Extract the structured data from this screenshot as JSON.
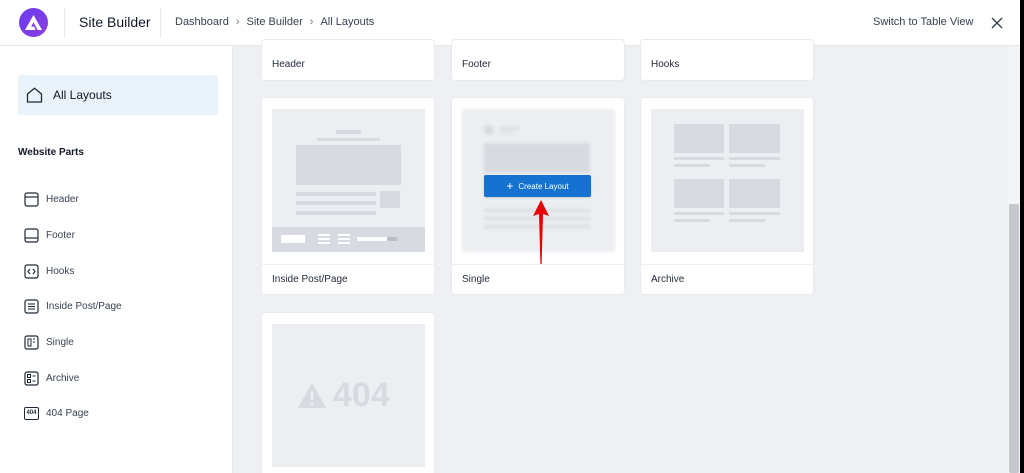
{
  "header": {
    "app_title": "Site Builder",
    "breadcrumb": [
      "Dashboard",
      "Site Builder",
      "All Layouts"
    ],
    "switch_label": "Switch to Table View"
  },
  "sidebar": {
    "all_layouts_label": "All Layouts",
    "section_title": "Website Parts",
    "items": [
      {
        "label": "Header",
        "icon": "header-layout-icon"
      },
      {
        "label": "Footer",
        "icon": "footer-layout-icon"
      },
      {
        "label": "Hooks",
        "icon": "code-brackets-icon"
      },
      {
        "label": "Inside Post/Page",
        "icon": "document-lines-icon"
      },
      {
        "label": "Single",
        "icon": "single-layout-icon"
      },
      {
        "label": "Archive",
        "icon": "archive-grid-icon"
      },
      {
        "label": "404 Page",
        "icon": "404-badge-icon",
        "badge": "404"
      }
    ]
  },
  "cards": {
    "header": "Header",
    "footer": "Footer",
    "hooks": "Hooks",
    "inside": "Inside Post/Page",
    "single": "Single",
    "archive": "Archive",
    "notfound_text": "404"
  },
  "create_button": "Create Layout",
  "colors": {
    "accent": "#1572d1",
    "logo": "#6a3bf0",
    "arrow": "#e60000"
  }
}
